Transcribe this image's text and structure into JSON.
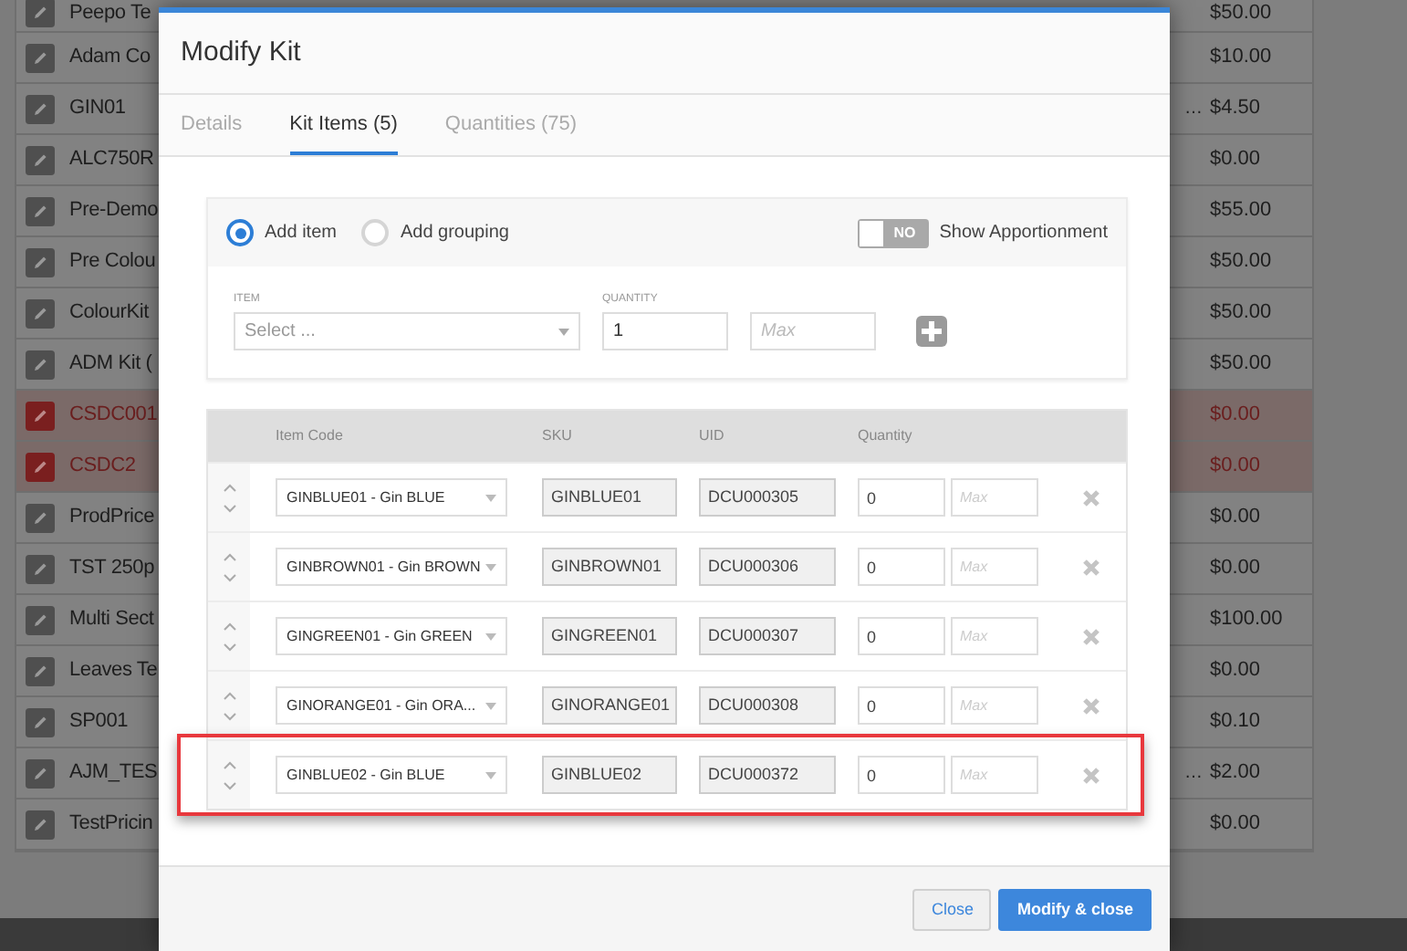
{
  "background_table": {
    "rows": [
      {
        "name": "Peepo Te",
        "price": "$50.00",
        "flagged": false
      },
      {
        "name": "Adam Co",
        "price": "$10.00",
        "flagged": false
      },
      {
        "name": "GIN01",
        "column_3": "…",
        "price": "$4.50",
        "flagged": false
      },
      {
        "name": "ALC750R",
        "price": "$0.00",
        "flagged": false
      },
      {
        "name": "Pre-Demo",
        "price": "$55.00",
        "flagged": false
      },
      {
        "name": "Pre Colou",
        "price": "$50.00",
        "flagged": false
      },
      {
        "name": "ColourKit",
        "price": "$50.00",
        "flagged": false
      },
      {
        "name": "ADM Kit (",
        "price": "$50.00",
        "flagged": false
      },
      {
        "name": "CSDC001",
        "price": "$0.00",
        "flagged": true
      },
      {
        "name": "CSDC2",
        "price": "$0.00",
        "flagged": true
      },
      {
        "name": "ProdPrice",
        "price": "$0.00",
        "flagged": false
      },
      {
        "name": "TST 250p",
        "price": "$0.00",
        "flagged": false
      },
      {
        "name": "Multi Sect",
        "price": "$100.00",
        "flagged": false
      },
      {
        "name": "Leaves Te",
        "price": "$0.00",
        "flagged": false
      },
      {
        "name": "SP001",
        "price": "$0.10",
        "flagged": false
      },
      {
        "name": "AJM_TES",
        "column_3": "…",
        "price": "$2.00",
        "flagged": false
      },
      {
        "name": "TestPricin",
        "price": "$0.00",
        "flagged": false
      }
    ]
  },
  "dialog": {
    "title": "Modify Kit",
    "tabs": [
      {
        "label": "Details",
        "selected": false
      },
      {
        "label": "Kit Items (5)",
        "selected": true
      },
      {
        "label": "Quantities (75)",
        "selected": false
      }
    ],
    "add_panel": {
      "modes": [
        {
          "label": "Add item",
          "selected": true
        },
        {
          "label": "Add grouping",
          "selected": false
        }
      ],
      "apportionment_toggle": {
        "label": "Show Apportionment",
        "state_text": "NO",
        "on": false
      },
      "item_label": "ITEM",
      "item_placeholder": "Select ...",
      "quantity_label": "QUANTITY",
      "quantity_value": "1",
      "max_placeholder": "Max"
    },
    "items_table": {
      "columns": [
        "Item Code",
        "SKU",
        "UID",
        "Quantity"
      ],
      "rows": [
        {
          "item": "GINBLUE01 - Gin BLUE",
          "sku": "GINBLUE01",
          "uid": "DCU000305",
          "quantity": "0",
          "max_placeholder": "Max",
          "highlighted": false
        },
        {
          "item": "GINBROWN01 - Gin BROWN",
          "sku": "GINBROWN01",
          "uid": "DCU000306",
          "quantity": "0",
          "max_placeholder": "Max",
          "highlighted": false
        },
        {
          "item": "GINGREEN01 - Gin GREEN",
          "sku": "GINGREEN01",
          "uid": "DCU000307",
          "quantity": "0",
          "max_placeholder": "Max",
          "highlighted": false
        },
        {
          "item": "GINORANGE01 - Gin ORA...",
          "sku": "GINORANGE01",
          "uid": "DCU000308",
          "quantity": "0",
          "max_placeholder": "Max",
          "highlighted": false
        },
        {
          "item": "GINBLUE02 - Gin BLUE",
          "sku": "GINBLUE02",
          "uid": "DCU000372",
          "quantity": "0",
          "max_placeholder": "Max",
          "highlighted": true
        }
      ]
    },
    "buttons": [
      {
        "label": "Close",
        "kind": "secondary"
      },
      {
        "label": "Modify & close",
        "kind": "primary"
      }
    ]
  }
}
